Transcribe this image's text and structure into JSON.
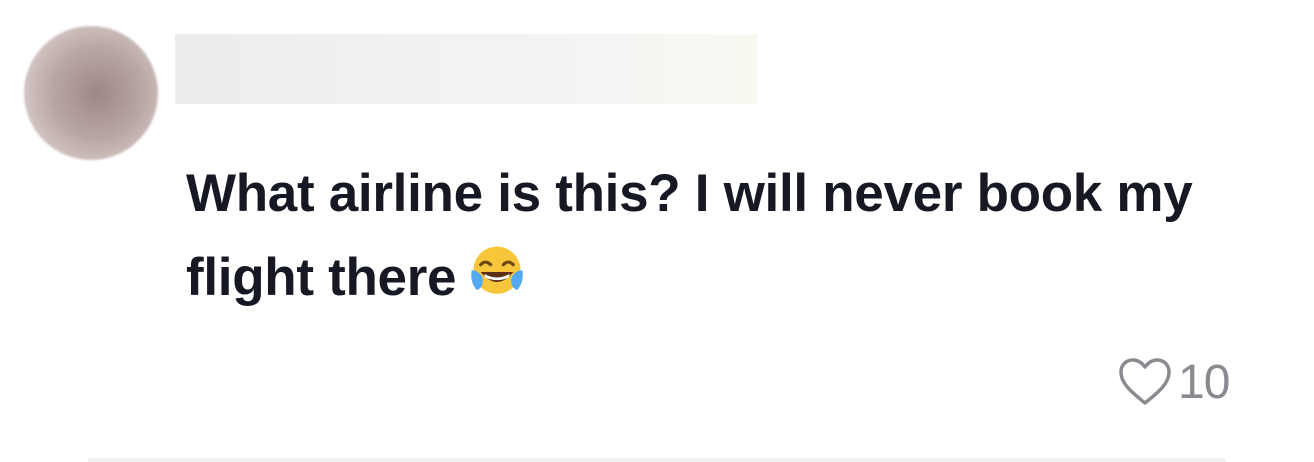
{
  "comment": {
    "text": "What airline is this? I will never book my flight there",
    "emoji": "face-with-tears-of-joy-icon",
    "likes": "10"
  },
  "colors": {
    "text": "#161823",
    "muted": "#8a8b91",
    "emoji_face": "#f8c63a",
    "emoji_tears": "#55a9f1"
  }
}
